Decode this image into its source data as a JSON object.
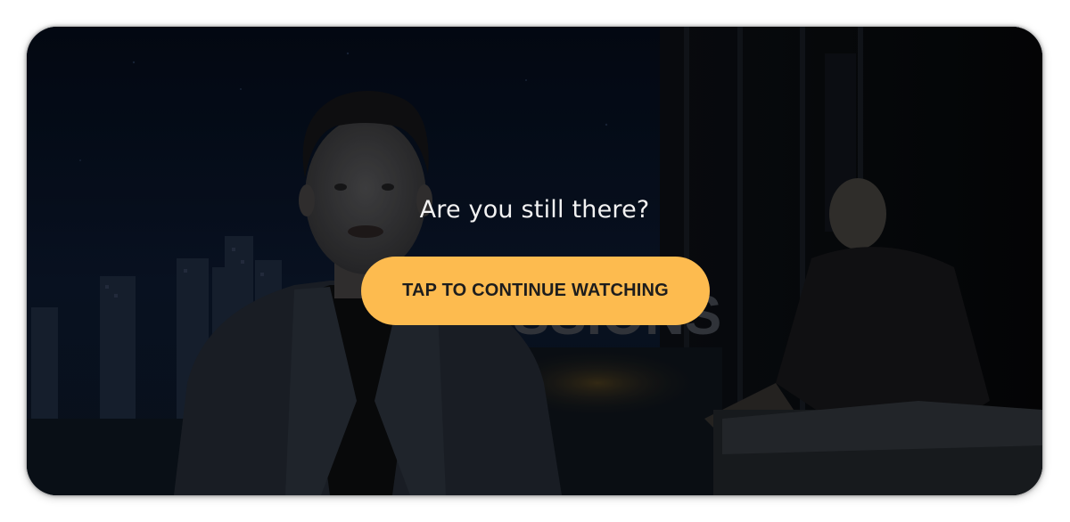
{
  "overlay": {
    "prompt": "Are you still there?",
    "continue_label": "TAP TO CONTINUE WATCHING"
  },
  "video": {
    "background_text": "SSIONS"
  },
  "colors": {
    "button": "#fdbb4f",
    "button_text": "#1d1d1d",
    "prompt_text": "#f2f2f2",
    "frame_bg": "#050b16"
  }
}
